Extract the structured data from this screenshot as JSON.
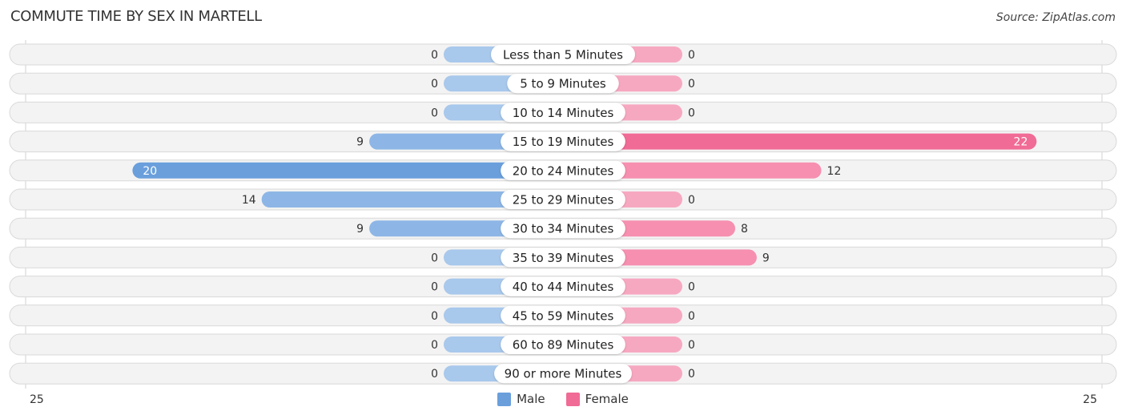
{
  "header": {
    "title": "COMMUTE TIME BY SEX IN MARTELL",
    "source": "Source: ZipAtlas.com"
  },
  "colors": {
    "male_strong": "#6a9fdc",
    "male_light": "#a8c8ec",
    "female_strong": "#f06b95",
    "female_light": "#f7a8c1"
  },
  "legend": {
    "male": "Male",
    "female": "Female"
  },
  "chart_data": {
    "type": "bar",
    "orientation": "horizontal-diverging",
    "title": "COMMUTE TIME BY SEX IN MARTELL",
    "categories": [
      "Less than 5 Minutes",
      "5 to 9 Minutes",
      "10 to 14 Minutes",
      "15 to 19 Minutes",
      "20 to 24 Minutes",
      "25 to 29 Minutes",
      "30 to 34 Minutes",
      "35 to 39 Minutes",
      "40 to 44 Minutes",
      "45 to 59 Minutes",
      "60 to 89 Minutes",
      "90 or more Minutes"
    ],
    "series": [
      {
        "name": "Male",
        "values": [
          0,
          0,
          0,
          9,
          20,
          14,
          9,
          0,
          0,
          0,
          0,
          0
        ]
      },
      {
        "name": "Female",
        "values": [
          0,
          0,
          0,
          22,
          12,
          0,
          8,
          9,
          0,
          0,
          0,
          0
        ]
      }
    ],
    "axis_max": 25,
    "axis_labels": {
      "left": "25",
      "right": "25"
    },
    "legend_position": "bottom-center",
    "grid": false
  }
}
